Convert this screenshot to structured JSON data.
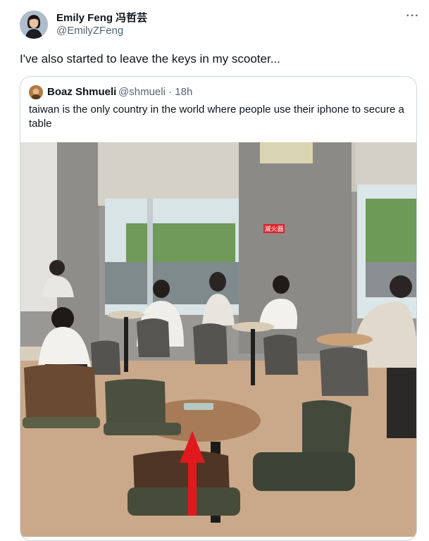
{
  "tweet": {
    "author_name": "Emily Feng 冯哲芸",
    "author_handle": "@EmilyZFeng",
    "more_icon": "more-horizontal-icon",
    "text": "I've also started to leave the keys in my scooter..."
  },
  "quote": {
    "author_name": "Boaz Shmueli",
    "author_handle": "@shmueli",
    "separator": "·",
    "time": "18h",
    "text": "taiwan is the only country in the world where people use their iphone to secure a table",
    "photo_sign_text": "滅火器"
  },
  "colors": {
    "text_primary": "#0f1419",
    "text_secondary": "#536471",
    "border": "#cfd9de",
    "arrow": "#e0191e"
  }
}
